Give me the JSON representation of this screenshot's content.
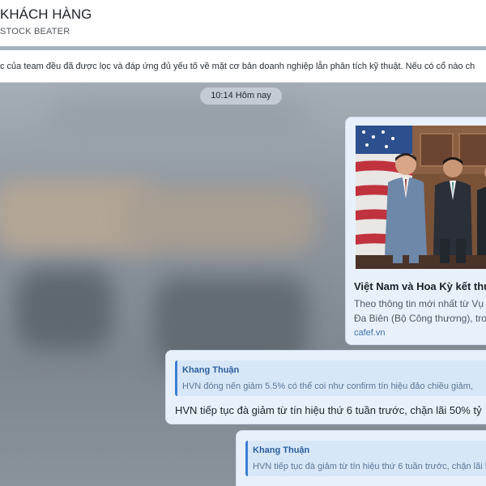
{
  "header": {
    "title": "KHÁCH HÀNG",
    "subtitle": "STOCK BEATER"
  },
  "pinned": {
    "text": "c của team đều đã được lọc và đáp ứng đủ yếu tố về mặt cơ bản doanh nghiệp lẫn phân tích kỹ thuật. Nếu có cổ nào ch"
  },
  "date_separator": "10:14 Hôm nay",
  "link_preview": {
    "title": "Việt Nam và Hoa Kỳ kết thúc",
    "description_lines": [
      "Theo thông tin mới nhất từ Vụ",
      "Đa Biên (Bộ Công thương), tro"
    ],
    "domain": "cafef.vn"
  },
  "messages": [
    {
      "reply_author": "Khang Thuận",
      "reply_text": "HVN đóng nến giảm 5.5% có thể coi như confirm tín hiệu đảo chiều giảm,",
      "body": "HVN tiếp tục đà giảm từ tín hiệu thứ 6 tuần trước, chặn lãi 50% tỷ"
    },
    {
      "reply_author": "Khang Thuận",
      "reply_text": "HVN tiếp tục đà giảm từ tín hiệu thứ 6 tuần trước, chặn lãi 5"
    }
  ],
  "colors": {
    "header_bg": "#ffffff",
    "chat_bg": "#8e969f",
    "bubble_bg": "#e8f1fb",
    "reply_bar": "#3b7fd1",
    "author": "#2a5f9e",
    "link": "#3f72b2"
  }
}
